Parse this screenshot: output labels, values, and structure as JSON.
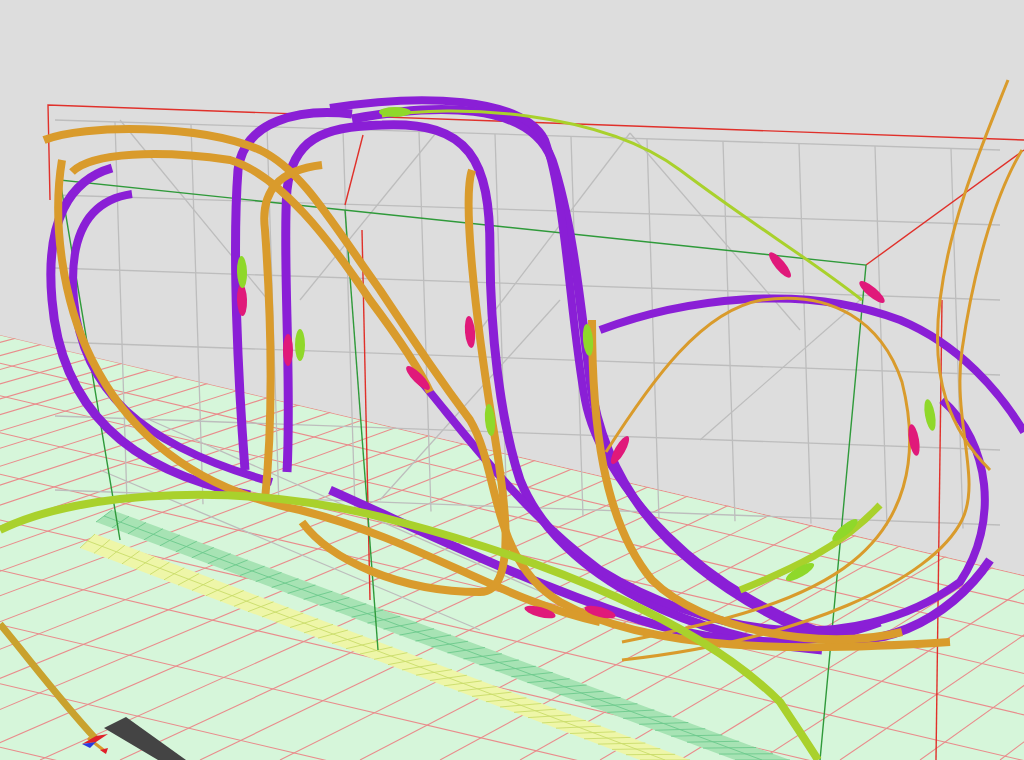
{
  "scene": {
    "tracks": [
      {
        "kind": "ribbon"
      },
      {
        "kind": "ribbon"
      },
      {
        "kind": "ribbon"
      },
      {
        "kind": "ribbon"
      },
      {
        "kind": "ribbon"
      },
      {
        "kind": "ribbon"
      },
      {
        "kind": "ribbon"
      },
      {
        "kind": "ribbon"
      },
      {
        "kind": "ribbon"
      },
      {
        "kind": "line"
      },
      {
        "kind": "line"
      },
      {
        "kind": "ribbon"
      },
      {
        "kind": "ribbon"
      },
      {
        "kind": "ribbon"
      },
      {
        "kind": "ribbon"
      },
      {
        "kind": "ribbon"
      },
      {
        "kind": "ribbon"
      },
      {
        "kind": "line"
      },
      {
        "kind": "ribbon"
      },
      {
        "kind": "ribbon"
      },
      {
        "kind": "line"
      },
      {
        "kind": "ribbon"
      }
    ]
  }
}
